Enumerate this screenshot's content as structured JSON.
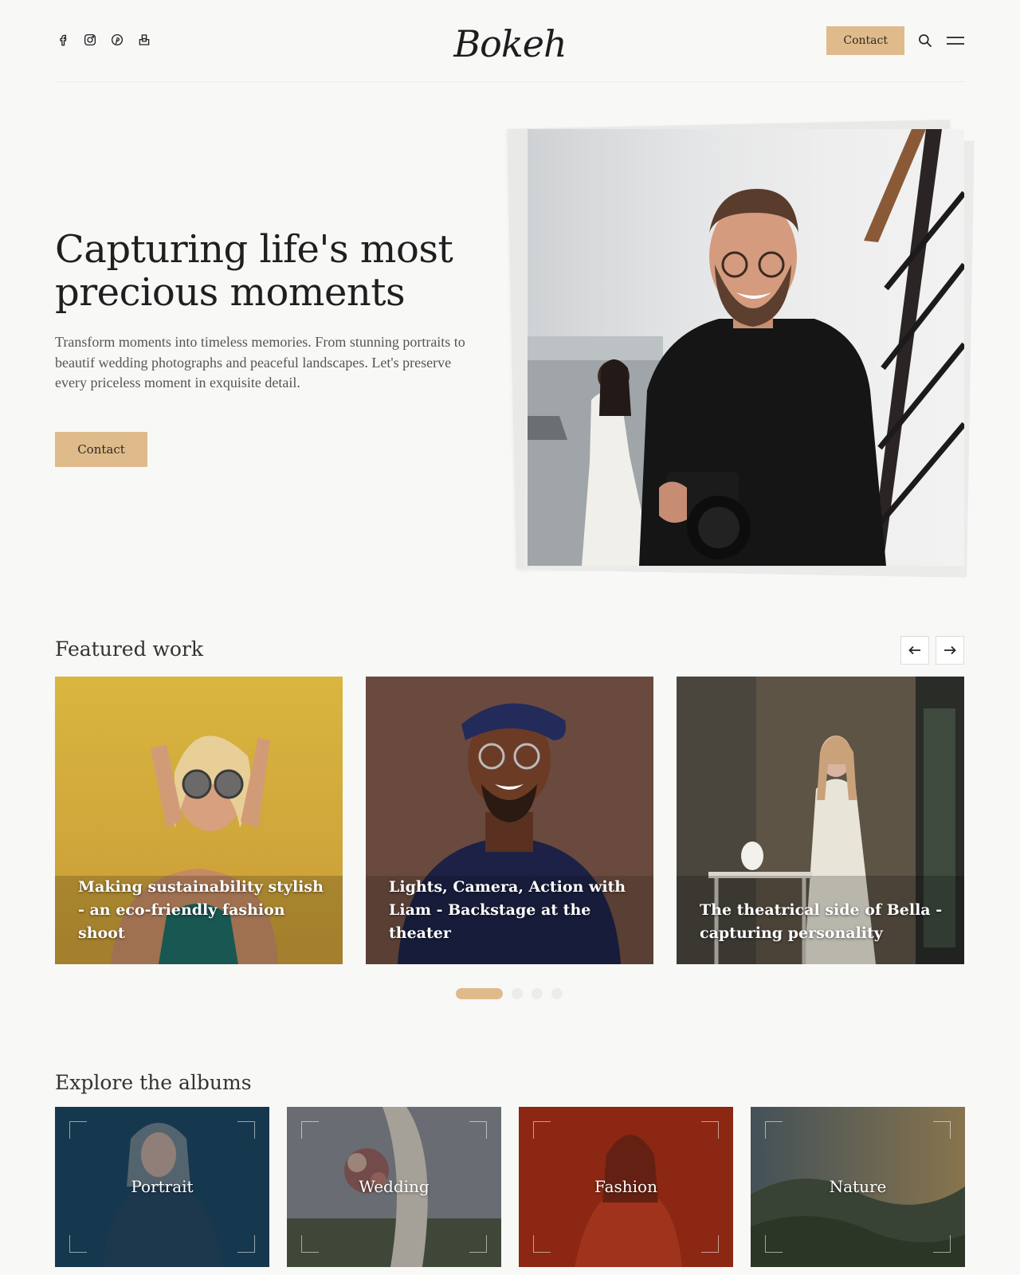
{
  "header": {
    "logo": "Bokeh",
    "contact_label": "Contact",
    "socials": [
      {
        "icon": "facebook-icon"
      },
      {
        "icon": "instagram-icon"
      },
      {
        "icon": "pinterest-icon"
      },
      {
        "icon": "unsplash-icon"
      }
    ],
    "search_icon": "search-icon",
    "menu_icon": "menu-icon"
  },
  "hero": {
    "title": "Capturing life's most precious moments",
    "text": "Transform moments into timeless memories. From stunning portraits to beautif wedding photographs and peaceful landscapes. Let's preserve every priceless moment in exquisite detail.",
    "button_label": "Contact"
  },
  "featured": {
    "title": "Featured work",
    "cards": [
      {
        "caption": "Making sustainability stylish - an eco-friendly fashion shoot"
      },
      {
        "caption": "Lights, Camera, Action with Liam - Backstage at the theater"
      },
      {
        "caption": "The theatrical side of Bella - capturing personality"
      }
    ],
    "active_slide": 1,
    "slide_count": 4
  },
  "albums": {
    "title": "Explore the albums",
    "items": [
      {
        "label": "Portrait"
      },
      {
        "label": "Wedding"
      },
      {
        "label": "Fashion"
      },
      {
        "label": "Nature"
      }
    ]
  },
  "colors": {
    "accent": "#dfbb8c",
    "background": "#f8f8f7",
    "text": "#1f1f1f"
  }
}
